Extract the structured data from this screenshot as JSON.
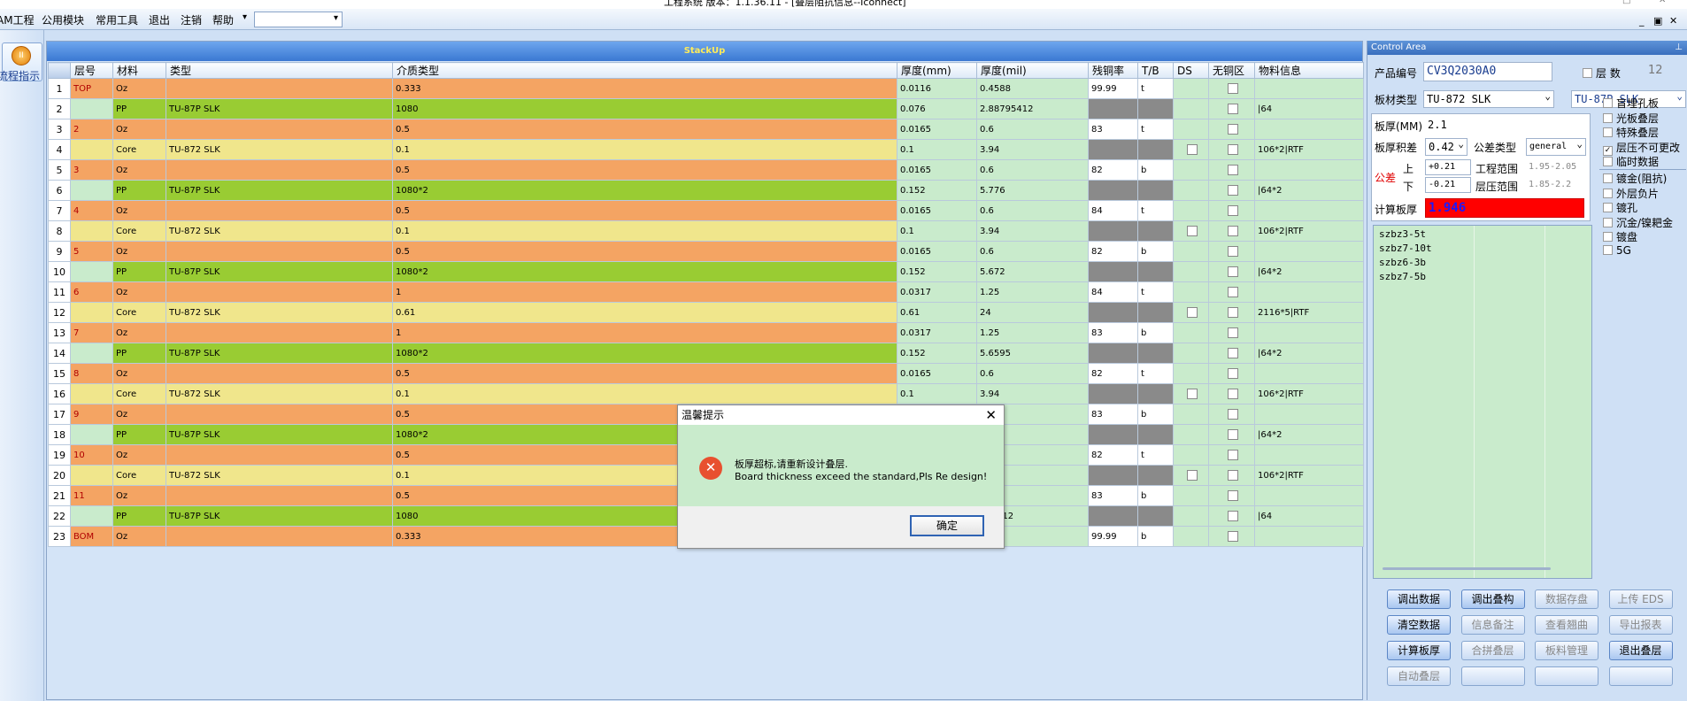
{
  "window": {
    "title": "工程系统   版本：1.1.36.11 - [叠层阻抗信息--Iconnect]"
  },
  "menu": {
    "items": [
      "AM工程",
      "公用模块",
      "常用工具",
      "退出",
      "注销",
      "帮助"
    ],
    "combo_arrow": "▾"
  },
  "sidebar": {
    "flow_button": "流程指示"
  },
  "stackup": {
    "header": "StackUp",
    "columns": [
      "",
      "层号",
      "材料",
      "类型",
      "介质类型",
      "厚度(mm)",
      "厚度(mil)",
      "残铜率",
      "T/B",
      "DS",
      "无铜区",
      "物料信息"
    ],
    "rows": [
      {
        "n": "1",
        "layer": "TOP",
        "mat": "Oz",
        "type": "",
        "med": "0.333",
        "mm": "0.0116",
        "mil": "0.4588",
        "cu": "99.99",
        "tb": "t",
        "ds": "",
        "info": "",
        "kind": "o"
      },
      {
        "n": "2",
        "layer": "",
        "mat": "PP",
        "type": "TU-87P SLK",
        "med": "1080",
        "mm": "0.076",
        "mil": "2.88795412",
        "cu": "",
        "tb": "",
        "ds": "",
        "info": "|64",
        "kind": "g"
      },
      {
        "n": "3",
        "layer": "2",
        "mat": "Oz",
        "type": "",
        "med": "0.5",
        "mm": "0.0165",
        "mil": "0.6",
        "cu": "83",
        "tb": "t",
        "ds": "",
        "info": "",
        "kind": "o"
      },
      {
        "n": "4",
        "layer": "",
        "mat": "Core",
        "type": "TU-872 SLK",
        "med": "0.1",
        "mm": "0.1",
        "mil": "3.94",
        "cu": "",
        "tb": "",
        "ds": "box",
        "info": "106*2|RTF",
        "kind": "y"
      },
      {
        "n": "5",
        "layer": "3",
        "mat": "Oz",
        "type": "",
        "med": "0.5",
        "mm": "0.0165",
        "mil": "0.6",
        "cu": "82",
        "tb": "b",
        "ds": "",
        "info": "",
        "kind": "o"
      },
      {
        "n": "6",
        "layer": "",
        "mat": "PP",
        "type": "TU-87P SLK",
        "med": "1080*2",
        "mm": "0.152",
        "mil": "5.776",
        "cu": "",
        "tb": "",
        "ds": "",
        "info": "|64*2",
        "kind": "g"
      },
      {
        "n": "7",
        "layer": "4",
        "mat": "Oz",
        "type": "",
        "med": "0.5",
        "mm": "0.0165",
        "mil": "0.6",
        "cu": "84",
        "tb": "t",
        "ds": "",
        "info": "",
        "kind": "o"
      },
      {
        "n": "8",
        "layer": "",
        "mat": "Core",
        "type": "TU-872 SLK",
        "med": "0.1",
        "mm": "0.1",
        "mil": "3.94",
        "cu": "",
        "tb": "",
        "ds": "box",
        "info": "106*2|RTF",
        "kind": "y"
      },
      {
        "n": "9",
        "layer": "5",
        "mat": "Oz",
        "type": "",
        "med": "0.5",
        "mm": "0.0165",
        "mil": "0.6",
        "cu": "82",
        "tb": "b",
        "ds": "",
        "info": "",
        "kind": "o"
      },
      {
        "n": "10",
        "layer": "",
        "mat": "PP",
        "type": "TU-87P SLK",
        "med": "1080*2",
        "mm": "0.152",
        "mil": "5.672",
        "cu": "",
        "tb": "",
        "ds": "",
        "info": "|64*2",
        "kind": "g"
      },
      {
        "n": "11",
        "layer": "6",
        "mat": "Oz",
        "type": "",
        "med": "1",
        "mm": "0.0317",
        "mil": "1.25",
        "cu": "84",
        "tb": "t",
        "ds": "",
        "info": "",
        "kind": "o"
      },
      {
        "n": "12",
        "layer": "",
        "mat": "Core",
        "type": "TU-872 SLK",
        "med": "0.61",
        "mm": "0.61",
        "mil": "24",
        "cu": "",
        "tb": "",
        "ds": "box",
        "info": "2116*5|RTF",
        "kind": "y"
      },
      {
        "n": "13",
        "layer": "7",
        "mat": "Oz",
        "type": "",
        "med": "1",
        "mm": "0.0317",
        "mil": "1.25",
        "cu": "83",
        "tb": "b",
        "ds": "",
        "info": "",
        "kind": "o"
      },
      {
        "n": "14",
        "layer": "",
        "mat": "PP",
        "type": "TU-87P SLK",
        "med": "1080*2",
        "mm": "0.152",
        "mil": "5.6595",
        "cu": "",
        "tb": "",
        "ds": "",
        "info": "|64*2",
        "kind": "g"
      },
      {
        "n": "15",
        "layer": "8",
        "mat": "Oz",
        "type": "",
        "med": "0.5",
        "mm": "0.0165",
        "mil": "0.6",
        "cu": "82",
        "tb": "t",
        "ds": "",
        "info": "",
        "kind": "o"
      },
      {
        "n": "16",
        "layer": "",
        "mat": "Core",
        "type": "TU-872 SLK",
        "med": "0.1",
        "mm": "0.1",
        "mil": "3.94",
        "cu": "",
        "tb": "",
        "ds": "box",
        "info": "106*2|RTF",
        "kind": "y"
      },
      {
        "n": "17",
        "layer": "9",
        "mat": "Oz",
        "type": "",
        "med": "0.5",
        "mm": "",
        "mil": "",
        "cu": "83",
        "tb": "b",
        "ds": "",
        "info": "",
        "kind": "o"
      },
      {
        "n": "18",
        "layer": "",
        "mat": "PP",
        "type": "TU-87P SLK",
        "med": "1080*2",
        "mm": "",
        "mil": "",
        "cu": "",
        "tb": "",
        "ds": "",
        "info": "|64*2",
        "kind": "g"
      },
      {
        "n": "19",
        "layer": "10",
        "mat": "Oz",
        "type": "",
        "med": "0.5",
        "mm": "",
        "mil": "",
        "cu": "82",
        "tb": "t",
        "ds": "",
        "info": "",
        "kind": "o"
      },
      {
        "n": "20",
        "layer": "",
        "mat": "Core",
        "type": "TU-872 SLK",
        "med": "0.1",
        "mm": "",
        "mil": "",
        "cu": "",
        "tb": "",
        "ds": "box",
        "info": "106*2|RTF",
        "kind": "y"
      },
      {
        "n": "21",
        "layer": "11",
        "mat": "Oz",
        "type": "",
        "med": "0.5",
        "mm": "",
        "mil": "",
        "cu": "83",
        "tb": "b",
        "ds": "",
        "info": "",
        "kind": "o"
      },
      {
        "n": "22",
        "layer": "",
        "mat": "PP",
        "type": "TU-87P SLK",
        "med": "1080",
        "mm": "",
        "mil": "795412",
        "cu": "",
        "tb": "",
        "ds": "",
        "info": "|64",
        "kind": "g"
      },
      {
        "n": "23",
        "layer": "BOM",
        "mat": "Oz",
        "type": "",
        "med": "0.333",
        "mm": "",
        "mil": "88",
        "cu": "99.99",
        "tb": "b",
        "ds": "",
        "info": "",
        "kind": "o"
      }
    ]
  },
  "control": {
    "header": "Control Area",
    "product_label": "产品编号",
    "product_value": "CV3Q2030A0",
    "layers_label": "层 数",
    "layers_value": "12",
    "board_type_label": "板材类型",
    "board_type_value": "TU-872 SLK",
    "pp_type_value": "TU-87P SLK",
    "thickness_label": "板厚(MM)",
    "thickness_value": "2.1",
    "tol_label": "板厚积差",
    "tol_value": "0.42",
    "tol_type_label": "公差类型",
    "tol_type_value": "general",
    "tol_word": "公差",
    "upper_label": "上",
    "lower_label": "下",
    "upper_value": "+0.21",
    "lower_value": "-0.21",
    "eng_range_label": "工程范围",
    "eng_range_value": "1.95-2.05",
    "press_range_label": "层压范围",
    "press_range_value": "1.85-2.2",
    "calc_label": "计算板厚",
    "calc_value": "1.946",
    "options": [
      {
        "label": "盲埋孔板",
        "checked": false
      },
      {
        "label": "光板叠层",
        "checked": false
      },
      {
        "label": "特殊叠层",
        "checked": false
      },
      {
        "label": "层压不可更改",
        "checked": true
      },
      {
        "label": "临时数据",
        "checked": false
      },
      {
        "label": "镀金(阻抗)",
        "checked": false
      },
      {
        "label": "外层负片",
        "checked": false
      },
      {
        "label": "镀孔",
        "checked": false
      },
      {
        "label": "沉金/镍耙金",
        "checked": false
      },
      {
        "label": "镀盘",
        "checked": false
      },
      {
        "label": "5G",
        "checked": false
      }
    ],
    "notes": [
      "szbz3-5t",
      "szbz7-10t",
      "szbz6-3b",
      "szbz7-5b"
    ],
    "buttons": [
      {
        "label": "调出数据",
        "enabled": true
      },
      {
        "label": "调出叠构",
        "enabled": true
      },
      {
        "label": "数据存盘",
        "enabled": false
      },
      {
        "label": "上传 EDS",
        "enabled": false
      },
      {
        "label": "清空数据",
        "enabled": true
      },
      {
        "label": "信息备注",
        "enabled": false
      },
      {
        "label": "查看翘曲",
        "enabled": false
      },
      {
        "label": "导出报表",
        "enabled": false
      },
      {
        "label": "计算板厚",
        "enabled": true
      },
      {
        "label": "合拼叠层",
        "enabled": false
      },
      {
        "label": "板料管理",
        "enabled": false
      },
      {
        "label": "退出叠层",
        "enabled": true
      },
      {
        "label": "自动叠层",
        "enabled": false
      },
      {
        "label": "",
        "enabled": false
      },
      {
        "label": "",
        "enabled": false
      },
      {
        "label": "",
        "enabled": false
      }
    ]
  },
  "dialog": {
    "title": "温馨提示",
    "message_cn": "板厚超标,请重新设计叠层.",
    "message_en": "Board thickness exceed the standard,Pls Re design!",
    "ok": "确定",
    "close": "✕",
    "icon": "✕"
  },
  "colors": {
    "oz": "#f4a463",
    "pp": "#99cc33",
    "core": "#f0e68c",
    "green": "#c9ebcc",
    "calc_bg": "#ff0000",
    "calc_fg": "#1a1aff"
  }
}
